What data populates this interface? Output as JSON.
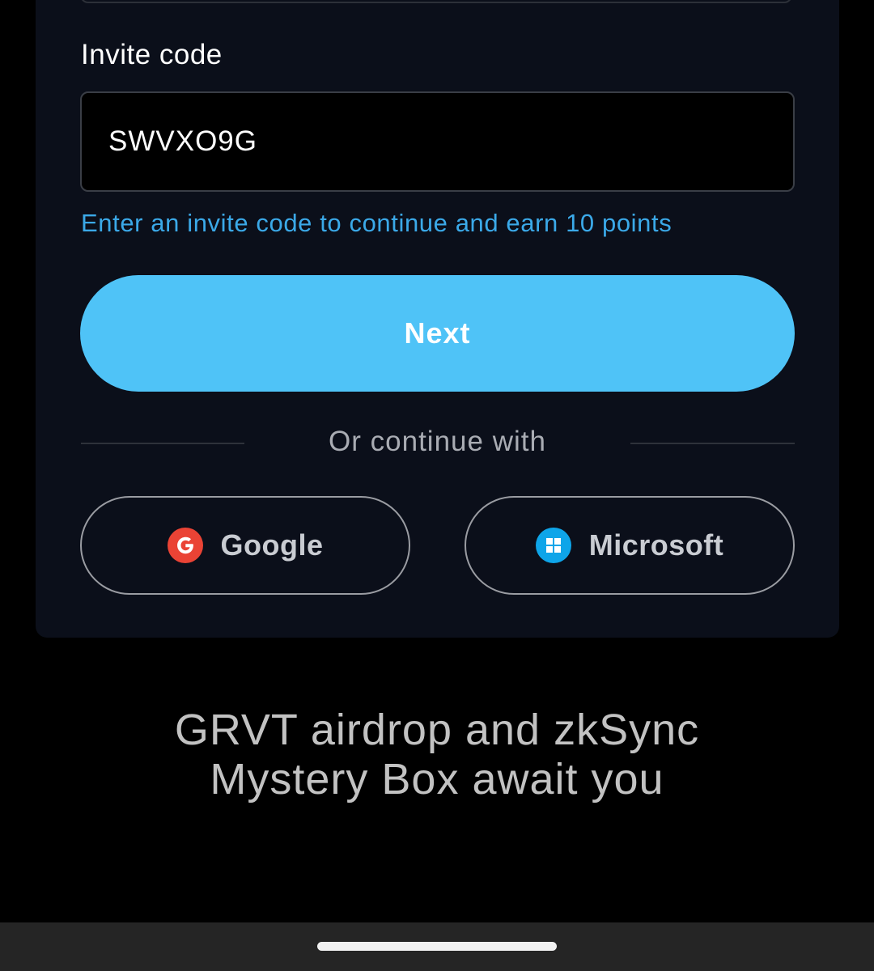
{
  "form": {
    "invite_label": "Invite code",
    "invite_value": "SWVXO9G",
    "invite_hint": "Enter an invite code to continue and earn 10 points",
    "next_label": "Next",
    "divider_text": "Or continue with"
  },
  "social": {
    "google_label": "Google",
    "google_icon": "google-icon",
    "microsoft_label": "Microsoft",
    "microsoft_icon": "microsoft-icon"
  },
  "promo": {
    "line1": "GRVT airdrop and zkSync",
    "line2": "Mystery Box await you"
  },
  "colors": {
    "background": "#000000",
    "card": "#0b0f1a",
    "accent": "#4fc3f7",
    "hint": "#3ba9e8",
    "google": "#ea4335",
    "microsoft": "#0ea5e9"
  }
}
